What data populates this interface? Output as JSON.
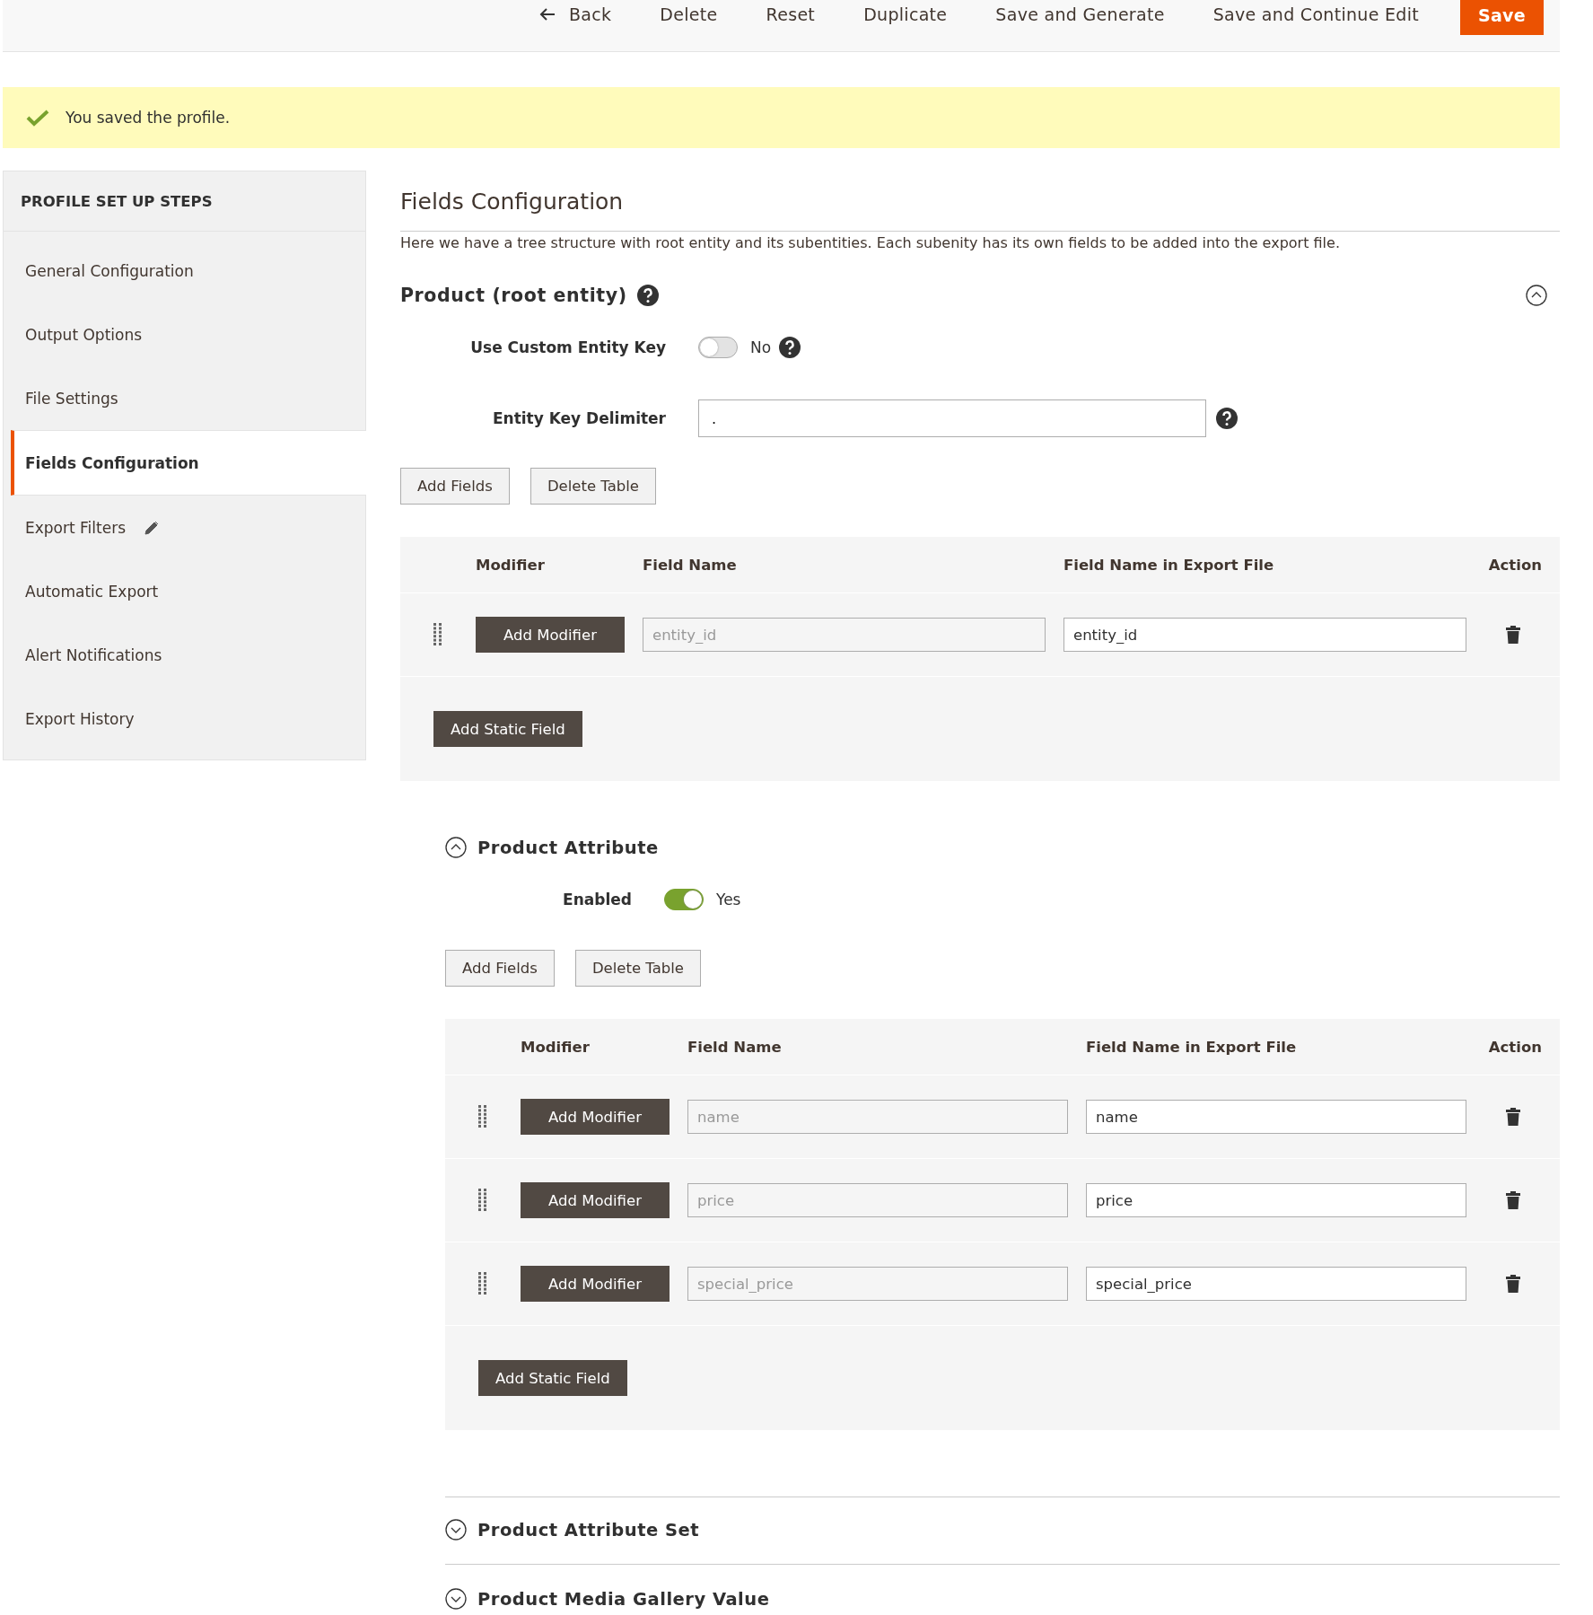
{
  "header": {
    "buttons": [
      {
        "label": "Back",
        "kind": "back"
      },
      {
        "label": "Delete",
        "kind": "plain"
      },
      {
        "label": "Reset",
        "kind": "plain"
      },
      {
        "label": "Duplicate",
        "kind": "plain"
      },
      {
        "label": "Save and Generate",
        "kind": "plain"
      },
      {
        "label": "Save and Continue Edit",
        "kind": "plain"
      },
      {
        "label": "Save",
        "kind": "primary"
      }
    ]
  },
  "message": {
    "text": "You saved the profile."
  },
  "sidebar": {
    "title": "PROFILE SET UP STEPS",
    "items": [
      {
        "label": "General Configuration",
        "selected": false,
        "kind": "plain"
      },
      {
        "label": "Output Options",
        "selected": false,
        "kind": "plain"
      },
      {
        "label": "File Settings",
        "selected": false,
        "kind": "plain"
      },
      {
        "label": "Fields Configuration",
        "selected": true,
        "kind": "plain"
      },
      {
        "label": "Export Filters",
        "selected": false,
        "kind": "edited"
      },
      {
        "label": "Automatic Export",
        "selected": false,
        "kind": "plain"
      },
      {
        "label": "Alert Notifications",
        "selected": false,
        "kind": "plain"
      },
      {
        "label": "Export History",
        "selected": false,
        "kind": "plain"
      }
    ]
  },
  "main": {
    "title": "Fields Configuration",
    "description": "Here we have a tree structure with root entity and its subentities. Each subenity has its own fields to be added into the export file.",
    "root": {
      "title": "Product (root entity)",
      "help": true,
      "expanded": true,
      "fields": [
        {
          "label": "Use Custom Entity Key",
          "kind": "toggle",
          "on": false,
          "state_text": "No",
          "help": true
        },
        {
          "label": "Entity Key Delimiter",
          "kind": "text",
          "value": ".",
          "help": true
        }
      ],
      "buttons": [
        "Add Fields",
        "Delete Table"
      ],
      "table": {
        "columns": [
          "Modifier",
          "Field Name",
          "Field Name in Export File",
          "Action"
        ],
        "rows": [
          {
            "modifier": "Add Modifier",
            "field_name": "entity_id",
            "export_name": "entity_id"
          }
        ]
      },
      "static_button": "Add Static Field"
    },
    "subentities": [
      {
        "title": "Product Attribute",
        "expanded": true,
        "enabled": {
          "label": "Enabled",
          "on": true,
          "state_text": "Yes"
        },
        "buttons": [
          "Add Fields",
          "Delete Table"
        ],
        "table": {
          "columns": [
            "Modifier",
            "Field Name",
            "Field Name in Export File",
            "Action"
          ],
          "rows": [
            {
              "modifier": "Add Modifier",
              "field_name": "name",
              "export_name": "name"
            },
            {
              "modifier": "Add Modifier",
              "field_name": "price",
              "export_name": "price"
            },
            {
              "modifier": "Add Modifier",
              "field_name": "special_price",
              "export_name": "special_price"
            }
          ]
        },
        "static_button": "Add Static Field"
      },
      {
        "title": "Product Attribute Set",
        "expanded": false
      },
      {
        "title": "Product Media Gallery Value",
        "expanded": false
      }
    ]
  }
}
